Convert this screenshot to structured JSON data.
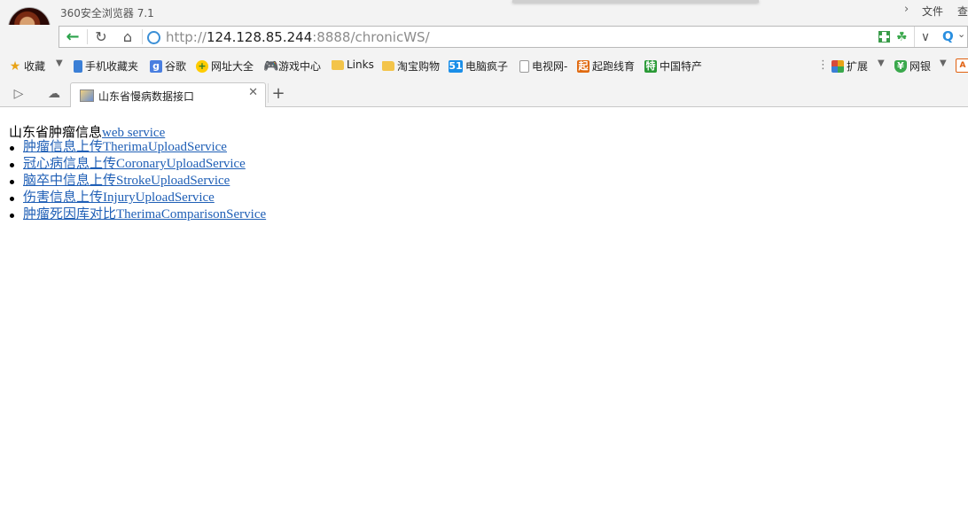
{
  "browser": {
    "app_title": "360安全浏览器 7.1",
    "menu_file": "文件",
    "menu_view": "查",
    "url": {
      "prefix": "http://",
      "host": "124.128.85.244",
      "rest": ":8888/chronicWS/"
    }
  },
  "bookmarks": [
    {
      "label": "收藏",
      "icon": "star-icon"
    },
    {
      "label": "手机收藏夹",
      "icon": "phone-icon"
    },
    {
      "label": "谷歌",
      "icon": "google-icon"
    },
    {
      "label": "网址大全",
      "icon": "web-directory-icon"
    },
    {
      "label": "游戏中心",
      "icon": "gamepad-icon"
    },
    {
      "label": "Links",
      "icon": "folder-icon"
    },
    {
      "label": "淘宝购物",
      "icon": "folder-icon"
    },
    {
      "label": "电脑疯子",
      "icon": "site-51-icon",
      "icon_text": "51"
    },
    {
      "label": "电视网-",
      "icon": "page-icon"
    },
    {
      "label": "起跑线育",
      "icon": "qi-icon",
      "icon_text": "起"
    },
    {
      "label": "中国特产",
      "icon": "te-icon",
      "icon_text": "特"
    }
  ],
  "toolbar_right": {
    "extensions": "扩展",
    "netbank": "网银"
  },
  "tab": {
    "title": "山东省慢病数据接口"
  },
  "page": {
    "heading_prefix": "山东省肿瘤信息",
    "heading_link": "web service",
    "services": [
      {
        "cn": "肿瘤信息上传",
        "name": "TherimaUploadService"
      },
      {
        "cn": "冠心病信息上传",
        "name": "CoronaryUploadService"
      },
      {
        "cn": "脑卒中信息上传",
        "name": "StrokeUploadService"
      },
      {
        "cn": "伤害信息上传",
        "name": "InjuryUploadService"
      },
      {
        "cn": "肿瘤死因库对比",
        "name": "TherimaComparisonService"
      }
    ]
  }
}
